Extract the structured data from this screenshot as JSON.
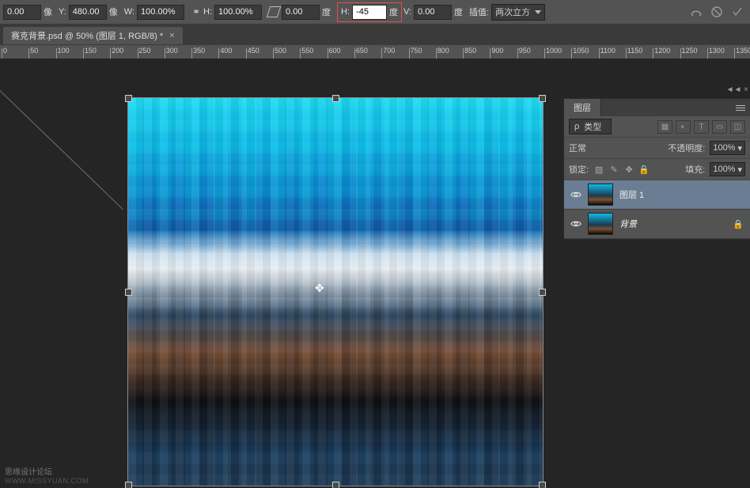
{
  "optbar": {
    "x_suffix": "像",
    "x_value": "0.00",
    "y_label": "Y:",
    "y_value": "480.00",
    "y_suffix": "像",
    "w_label": "W:",
    "w_value": "100.00%",
    "h_label": "H:",
    "h_value": "100.00%",
    "rot_value": "0.00",
    "deg": "度",
    "skewH_label": "H:",
    "skewH_value": "-45",
    "skewV_label": "V:",
    "skewV_value": "0.00",
    "interp_label": "插值:",
    "interp_value": "两次立方"
  },
  "tab": {
    "title": "赛克背景.psd @ 50% (图层 1, RGB/8) *"
  },
  "ruler": {
    "marks": [
      "0",
      "50",
      "100",
      "150",
      "200",
      "250",
      "300",
      "350",
      "400",
      "450",
      "500",
      "550",
      "600",
      "650",
      "700",
      "750",
      "800",
      "850",
      "900",
      "950",
      "1000",
      "1050",
      "1100",
      "1150",
      "1200",
      "1250",
      "1300",
      "1350"
    ]
  },
  "layerspanel": {
    "title": "图层",
    "kind_label": "类型",
    "blend_mode": "正常",
    "opacity_label": "不透明度:",
    "opacity_value": "100%",
    "lock_label": "锁定:",
    "fill_label": "填充:",
    "fill_value": "100%",
    "layers": [
      {
        "name": "图层 1",
        "locked": false,
        "selected": true
      },
      {
        "name": "背景",
        "locked": true,
        "selected": false
      }
    ]
  },
  "watermark": {
    "line1": "思缘设计论坛",
    "line2": "WWW.MISSYUAN.COM"
  }
}
